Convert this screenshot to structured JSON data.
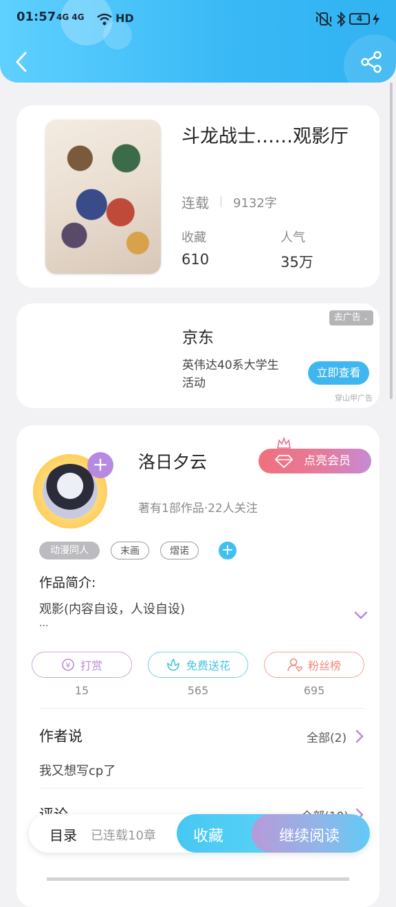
{
  "status_bar": {
    "time": "01:57",
    "network": "4G 4G",
    "hd": "HD",
    "battery": "4"
  },
  "book": {
    "title": "斗龙战士……观影厅",
    "status": "连载",
    "word_count": "9132字",
    "collect_label": "收藏",
    "collect_value": "610",
    "popularity_label": "人气",
    "popularity_value": "35万"
  },
  "ad": {
    "close_label": "去广告",
    "brand": "京东",
    "text": "英伟达40系大学生活动",
    "text_line1": "英伟达40系大学生",
    "text_line2": "活动",
    "cta": "立即查看",
    "source": "穿山甲广告"
  },
  "author": {
    "name": "洛日夕云",
    "vip_button": "点亮会员",
    "stats": "著有1部作品·22人关注",
    "tags": [
      "动漫同人",
      "末画",
      "熠诺"
    ],
    "intro_label": "作品简介:",
    "intro_text": "观影(内容自设，人设自设)",
    "intro_more": "..."
  },
  "actions": [
    {
      "label": "打赏",
      "count": "15"
    },
    {
      "label": "免费送花",
      "count": "565"
    },
    {
      "label": "粉丝榜",
      "count": "695"
    }
  ],
  "author_says": {
    "title": "作者说",
    "all": "全部(2)",
    "content": "我又想写cp了"
  },
  "comments": {
    "title": "评论",
    "all": "全部(10)"
  },
  "bottom_bar": {
    "catalog": "目录",
    "chapters": "已连载10章",
    "collect": "收藏",
    "continue": "继续阅读"
  },
  "colors": {
    "header": "#38b8f5",
    "accent_blue": "#3fb6f0",
    "vip_pink": "#f06b8a",
    "reward_purple": "#b98ad8",
    "flower_cyan": "#45c6dc",
    "fans_red": "#f08a7a"
  }
}
